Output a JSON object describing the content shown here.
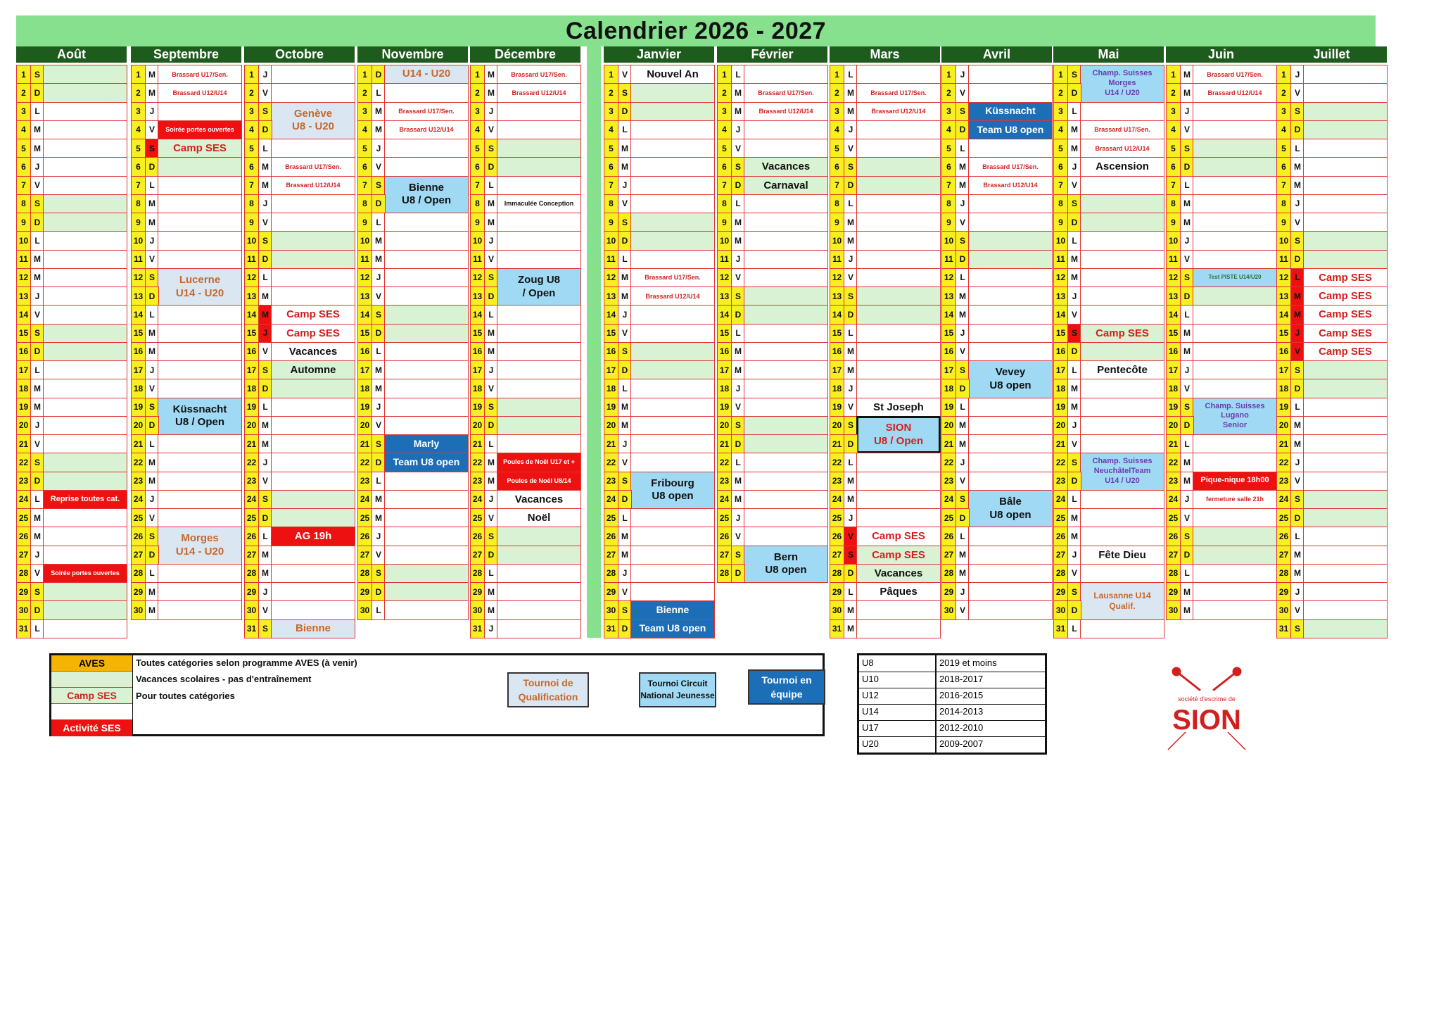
{
  "title": "Calendrier 2026 - 2027",
  "colors": {
    "header_green": "#86e08e",
    "month_bar": "#1e5c1e",
    "day_yellow": "#f7ef1f",
    "weekend_green": "#d9f2d3",
    "grid_red": "#e03333",
    "activity_red": "#ee1111",
    "qualification_bg": "#dbe6f3",
    "circuit_bg": "#9fd9f4",
    "team_bg": "#1c6fb7",
    "aves_orange": "#f5b400"
  },
  "months": [
    {
      "name": "Août",
      "letters": "SDLMMJVSDLMMJVSDLMMJVSDLMMJVSDL"
    },
    {
      "name": "Septembre",
      "letters": "MMJVSDLMMJVSDLMMJVSDLMMJVSDLMM"
    },
    {
      "name": "Octobre",
      "letters": "JVSDLMMJVSDLMMJVSDLMMJVSDLMMJVS"
    },
    {
      "name": "Novembre",
      "letters": "DLMMJVSDLMMJVSDLMMJVSDLMMJVSDL"
    },
    {
      "name": "Décembre",
      "letters": "MMJVSDLMMJVSDLMMJVSDLMMJVSDLMMJ"
    },
    {
      "name": "Janvier",
      "letters": "VSDLMMJVSDLMMJVSDLMMJVSDLMMJVSD"
    },
    {
      "name": "Février",
      "letters": "LMMJVSDLMMJVSDLMMJVSDLMMJVSD"
    },
    {
      "name": "Mars",
      "letters": "LMMJVSDLMMJVSDLMMJVSDLMMJVSDLMM"
    },
    {
      "name": "Avril",
      "letters": "JVSDLMMJVSDLMMJVSDLMMJVSDLMMJV"
    },
    {
      "name": "Mai",
      "letters": "SDLMMJVSDLMMJVSDLMMJVSDLMMJVSDL"
    },
    {
      "name": "Juin",
      "letters": "MMJVSDLMMJVSDLMMJVSDLMMJVSDLMM"
    },
    {
      "name": "Juillet",
      "letters": "JVSDLMMJVSDLMMJVSDLMMJVSDLMMJVS"
    }
  ],
  "red_letter_days": [
    [
      1,
      5
    ],
    [
      2,
      14
    ],
    [
      2,
      15
    ],
    [
      7,
      26
    ],
    [
      7,
      27
    ],
    [
      9,
      15
    ],
    [
      11,
      12
    ],
    [
      11,
      13
    ],
    [
      11,
      14
    ],
    [
      11,
      15
    ],
    [
      11,
      16
    ]
  ],
  "events": [
    {
      "m": 0,
      "d": 24,
      "span": 1,
      "text": "Reprise toutes cat.",
      "style": "redbox"
    },
    {
      "m": 0,
      "d": 28,
      "span": 1,
      "text": "Soirée portes ouvertes",
      "style": "smallred"
    },
    {
      "m": 1,
      "d": 1,
      "span": 1,
      "text": "Brassard U17/Sen.",
      "style": "small"
    },
    {
      "m": 1,
      "d": 2,
      "span": 1,
      "text": "Brassard U12/U14",
      "style": "small"
    },
    {
      "m": 1,
      "d": 4,
      "span": 1,
      "text": "Soirée portes ouvertes",
      "style": "smallred"
    },
    {
      "m": 1,
      "d": 5,
      "span": 1,
      "text": "Camp SES",
      "style": "ses"
    },
    {
      "m": 1,
      "d": 12,
      "span": 2,
      "text": "Lucerne\nU14 - U20",
      "style": "qual"
    },
    {
      "m": 1,
      "d": 19,
      "span": 2,
      "text": "Küssnacht\nU8 / Open",
      "style": "circuit"
    },
    {
      "m": 1,
      "d": 26,
      "span": 2,
      "text": "Morges\nU14 - U20",
      "style": "qual"
    },
    {
      "m": 2,
      "d": 3,
      "span": 2,
      "text": "Genève\nU8 - U20",
      "style": "qual"
    },
    {
      "m": 2,
      "d": 6,
      "span": 1,
      "text": "Brassard U17/Sen.",
      "style": "small"
    },
    {
      "m": 2,
      "d": 7,
      "span": 1,
      "text": "Brassard U12/U14",
      "style": "small"
    },
    {
      "m": 2,
      "d": 14,
      "span": 1,
      "text": "Camp SES",
      "style": "ses"
    },
    {
      "m": 2,
      "d": 15,
      "span": 1,
      "text": "Camp SES",
      "style": "ses"
    },
    {
      "m": 2,
      "d": 16,
      "span": 1,
      "text": "Vacances",
      "style": "black"
    },
    {
      "m": 2,
      "d": 17,
      "span": 1,
      "text": "Automne",
      "style": "black"
    },
    {
      "m": 2,
      "d": 26,
      "span": 1,
      "text": "AG 19h",
      "style": "redbig"
    },
    {
      "m": 2,
      "d": 31,
      "span": 1,
      "text": "Bienne",
      "style": "qual"
    },
    {
      "m": 3,
      "d": 1,
      "span": 1,
      "text": "U14 - U20",
      "style": "qual"
    },
    {
      "m": 3,
      "d": 3,
      "span": 1,
      "text": "Brassard U17/Sen.",
      "style": "small"
    },
    {
      "m": 3,
      "d": 4,
      "span": 1,
      "text": "Brassard U12/U14",
      "style": "small"
    },
    {
      "m": 3,
      "d": 7,
      "span": 2,
      "text": "Bienne\nU8 / Open",
      "style": "circuit"
    },
    {
      "m": 3,
      "d": 21,
      "span": 1,
      "text": "Marly",
      "style": "team"
    },
    {
      "m": 3,
      "d": 22,
      "span": 1,
      "text": "Team U8 open",
      "style": "team"
    },
    {
      "m": 4,
      "d": 1,
      "span": 1,
      "text": "Brassard U17/Sen.",
      "style": "small"
    },
    {
      "m": 4,
      "d": 2,
      "span": 1,
      "text": "Brassard U12/U14",
      "style": "small"
    },
    {
      "m": 4,
      "d": 8,
      "span": 1,
      "text": "Immaculée Conception",
      "style": "tiny"
    },
    {
      "m": 4,
      "d": 12,
      "span": 2,
      "text": "Zoug U8\n/ Open",
      "style": "circuit"
    },
    {
      "m": 4,
      "d": 22,
      "span": 1,
      "text": "Poules de Noël U17 et +",
      "style": "smallred"
    },
    {
      "m": 4,
      "d": 23,
      "span": 1,
      "text": "Poules de Noël U8/14",
      "style": "smallred"
    },
    {
      "m": 4,
      "d": 24,
      "span": 1,
      "text": "Vacances",
      "style": "black"
    },
    {
      "m": 4,
      "d": 25,
      "span": 1,
      "text": "Noël",
      "style": "black"
    },
    {
      "m": 5,
      "d": 1,
      "span": 1,
      "text": "Nouvel An",
      "style": "black"
    },
    {
      "m": 5,
      "d": 12,
      "span": 1,
      "text": "Brassard U17/Sen.",
      "style": "small"
    },
    {
      "m": 5,
      "d": 13,
      "span": 1,
      "text": "Brassard U12/U14",
      "style": "small"
    },
    {
      "m": 5,
      "d": 23,
      "span": 2,
      "text": "Fribourg\nU8 open",
      "style": "circuit"
    },
    {
      "m": 5,
      "d": 30,
      "span": 1,
      "text": "Bienne",
      "style": "team"
    },
    {
      "m": 5,
      "d": 31,
      "span": 1,
      "text": "Team U8 open",
      "style": "team"
    },
    {
      "m": 6,
      "d": 2,
      "span": 1,
      "text": "Brassard U17/Sen.",
      "style": "small"
    },
    {
      "m": 6,
      "d": 3,
      "span": 1,
      "text": "Brassard U12/U14",
      "style": "small"
    },
    {
      "m": 6,
      "d": 6,
      "span": 1,
      "text": "Vacances",
      "style": "black"
    },
    {
      "m": 6,
      "d": 7,
      "span": 1,
      "text": "Carnaval",
      "style": "black"
    },
    {
      "m": 6,
      "d": 27,
      "span": 2,
      "text": "Bern\nU8 open",
      "style": "circuit"
    },
    {
      "m": 7,
      "d": 2,
      "span": 1,
      "text": "Brassard U17/Sen.",
      "style": "small"
    },
    {
      "m": 7,
      "d": 3,
      "span": 1,
      "text": "Brassard U12/U14",
      "style": "small"
    },
    {
      "m": 7,
      "d": 19,
      "span": 1,
      "text": "St Joseph",
      "style": "black"
    },
    {
      "m": 7,
      "d": 20,
      "span": 2,
      "text": "SION\nU8 / Open",
      "style": "sion"
    },
    {
      "m": 7,
      "d": 26,
      "span": 1,
      "text": "Camp SES",
      "style": "ses"
    },
    {
      "m": 7,
      "d": 27,
      "span": 1,
      "text": "Camp SES",
      "style": "ses"
    },
    {
      "m": 7,
      "d": 28,
      "span": 1,
      "text": "Vacances",
      "style": "black"
    },
    {
      "m": 7,
      "d": 29,
      "span": 1,
      "text": "Pâques",
      "style": "black"
    },
    {
      "m": 8,
      "d": 3,
      "span": 1,
      "text": "Küssnacht",
      "style": "team"
    },
    {
      "m": 8,
      "d": 4,
      "span": 1,
      "text": "Team U8 open",
      "style": "team"
    },
    {
      "m": 8,
      "d": 6,
      "span": 1,
      "text": "Brassard U17/Sen.",
      "style": "small"
    },
    {
      "m": 8,
      "d": 7,
      "span": 1,
      "text": "Brassard U12/U14",
      "style": "small"
    },
    {
      "m": 8,
      "d": 17,
      "span": 2,
      "text": "Vevey\nU8 open",
      "style": "circuit"
    },
    {
      "m": 8,
      "d": 24,
      "span": 2,
      "text": "Bâle\nU8 open",
      "style": "circuit"
    },
    {
      "m": 9,
      "d": 1,
      "span": 2,
      "text": "Champ. Suisses\nMorges\nU14 / U20",
      "style": "champ"
    },
    {
      "m": 9,
      "d": 4,
      "span": 1,
      "text": "Brassard U17/Sen.",
      "style": "small"
    },
    {
      "m": 9,
      "d": 5,
      "span": 1,
      "text": "Brassard U12/U14",
      "style": "small"
    },
    {
      "m": 9,
      "d": 6,
      "span": 1,
      "text": "Ascension",
      "style": "black"
    },
    {
      "m": 9,
      "d": 15,
      "span": 1,
      "text": "Camp SES",
      "style": "ses"
    },
    {
      "m": 9,
      "d": 17,
      "span": 1,
      "text": "Pentecôte",
      "style": "black"
    },
    {
      "m": 9,
      "d": 22,
      "span": 2,
      "text": "Champ. Suisses\nNeuchâtelTeam\nU14 / U20",
      "style": "champ"
    },
    {
      "m": 9,
      "d": 27,
      "span": 1,
      "text": "Fête Dieu",
      "style": "black"
    },
    {
      "m": 9,
      "d": 29,
      "span": 2,
      "text": "Lausanne U14\nQualif.",
      "style": "qual11"
    },
    {
      "m": 10,
      "d": 1,
      "span": 1,
      "text": "Brassard U17/Sen.",
      "style": "small"
    },
    {
      "m": 10,
      "d": 2,
      "span": 1,
      "text": "Brassard U12/U14",
      "style": "small"
    },
    {
      "m": 10,
      "d": 12,
      "span": 1,
      "text": "Test PISTE U14/U20",
      "style": "piste"
    },
    {
      "m": 10,
      "d": 19,
      "span": 2,
      "text": "Champ. Suisses\nLugano\nSenior",
      "style": "champ"
    },
    {
      "m": 10,
      "d": 23,
      "span": 1,
      "text": "Pique-nique 18h00",
      "style": "redbox"
    },
    {
      "m": 10,
      "d": 24,
      "span": 1,
      "text": "fermeture salle 21h",
      "style": "small"
    },
    {
      "m": 11,
      "d": 12,
      "span": 1,
      "text": "Camp SES",
      "style": "ses"
    },
    {
      "m": 11,
      "d": 13,
      "span": 1,
      "text": "Camp SES",
      "style": "ses"
    },
    {
      "m": 11,
      "d": 14,
      "span": 1,
      "text": "Camp SES",
      "style": "ses"
    },
    {
      "m": 11,
      "d": 15,
      "span": 1,
      "text": "Camp SES",
      "style": "ses"
    },
    {
      "m": 11,
      "d": 16,
      "span": 1,
      "text": "Camp SES",
      "style": "ses"
    }
  ],
  "legend": {
    "rows": [
      {
        "swatch": "AVES",
        "text": "Toutes catégories selon programme AVES (à venir)"
      },
      {
        "swatch": "",
        "text": "Vacances scolaires - pas d'entraînement"
      },
      {
        "swatch": "Camp SES",
        "text": "Pour toutes catégories"
      },
      {
        "swatch": "",
        "text": ""
      },
      {
        "swatch": "Activité SES",
        "text": ""
      }
    ],
    "boxes": {
      "qualification": "Tournoi de\nQualification",
      "circuit": "Tournoi Circuit\nNational Jeunesse",
      "team": "Tournoi en\néquipe"
    }
  },
  "age_table": [
    {
      "cat": "U8",
      "years": "2019 et moins"
    },
    {
      "cat": "U10",
      "years": "2018-2017"
    },
    {
      "cat": "U12",
      "years": "2016-2015"
    },
    {
      "cat": "U14",
      "years": "2014-2013"
    },
    {
      "cat": "U17",
      "years": "2012-2010"
    },
    {
      "cat": "U20",
      "years": "2009-2007"
    }
  ],
  "logo": {
    "line1": "société d'escrime de",
    "line2": "SION"
  }
}
